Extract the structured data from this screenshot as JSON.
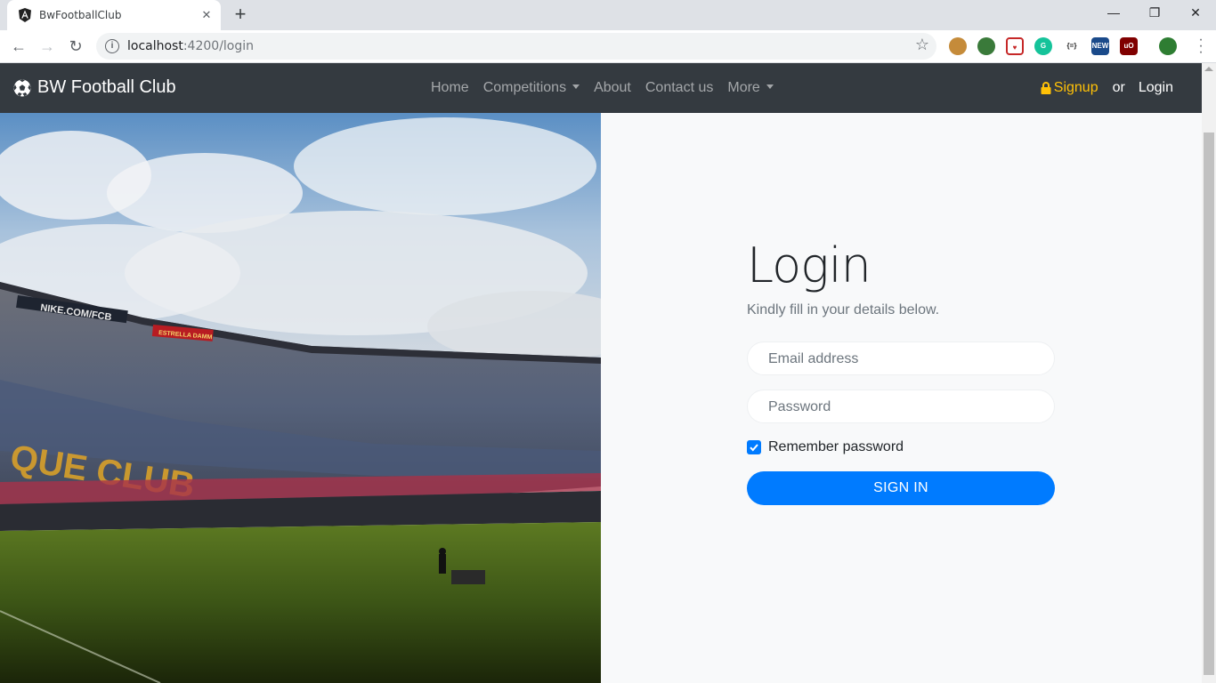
{
  "browser": {
    "tab_title": "BwFootballClub",
    "tab_icon": "angular-icon",
    "url_host": "localhost",
    "url_path": ":4200/login",
    "window_controls": [
      "minimize",
      "restore",
      "close"
    ]
  },
  "navbar": {
    "brand": "BW Football Club",
    "brand_icon": "soccer-ball-icon",
    "links": [
      {
        "label": "Home"
      },
      {
        "label": "Competitions",
        "dropdown": true
      },
      {
        "label": "About"
      },
      {
        "label": "Contact us"
      },
      {
        "label": "More",
        "dropdown": true
      }
    ],
    "signup_label": "Signup",
    "or_label": "or",
    "login_label": "Login"
  },
  "login": {
    "title": "Login",
    "subtitle": "Kindly fill in your details below.",
    "email_placeholder": "Email address",
    "password_placeholder": "Password",
    "remember_label": "Remember password",
    "remember_checked": true,
    "submit_label": "SIGN IN"
  },
  "hero": {
    "banners": [
      "NIKE.COM/FCB",
      "ESTRELLA DAMM"
    ],
    "seat_text": "QUE CLUB"
  },
  "colors": {
    "navbar_bg": "#343a40",
    "signup": "#ffc107",
    "primary": "#007bff",
    "panel_bg": "#f8f9fa"
  }
}
